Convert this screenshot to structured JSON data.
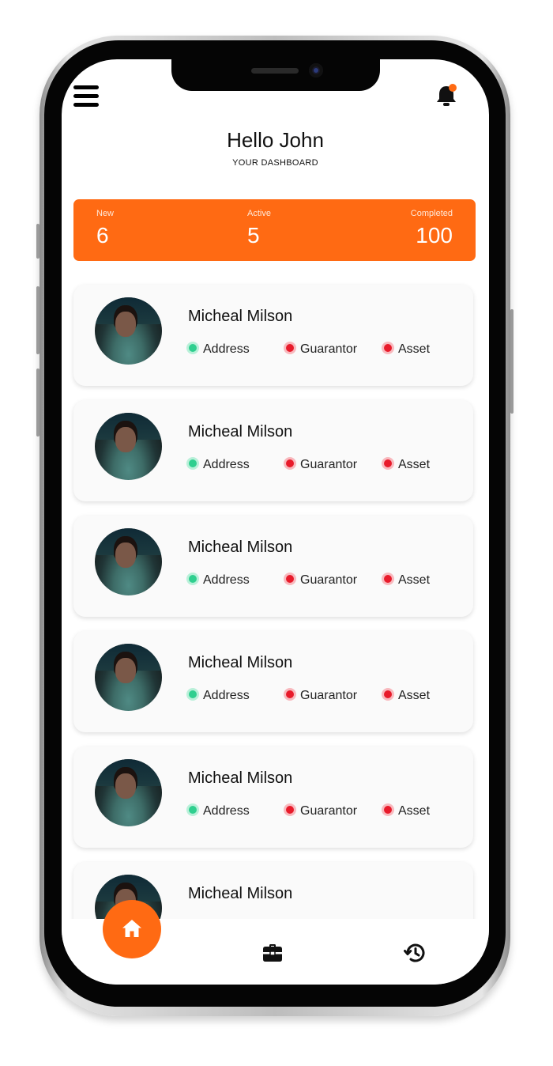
{
  "header": {
    "greeting": "Hello John",
    "subtitle": "YOUR DASHBOARD",
    "menu_icon": "hamburger-menu-icon",
    "notification_icon": "bell-icon"
  },
  "stats": [
    {
      "label": "New",
      "value": "6"
    },
    {
      "label": "Active",
      "value": "5"
    },
    {
      "label": "Completed",
      "value": "100"
    }
  ],
  "list": [
    {
      "name": "Micheal Milson",
      "tags": [
        {
          "label": "Address",
          "status": "green"
        },
        {
          "label": "Guarantor",
          "status": "red"
        },
        {
          "label": "Asset",
          "status": "red"
        }
      ]
    },
    {
      "name": "Micheal Milson",
      "tags": [
        {
          "label": "Address",
          "status": "green"
        },
        {
          "label": "Guarantor",
          "status": "red"
        },
        {
          "label": "Asset",
          "status": "red"
        }
      ]
    },
    {
      "name": "Micheal Milson",
      "tags": [
        {
          "label": "Address",
          "status": "green"
        },
        {
          "label": "Guarantor",
          "status": "red"
        },
        {
          "label": "Asset",
          "status": "red"
        }
      ]
    },
    {
      "name": "Micheal Milson",
      "tags": [
        {
          "label": "Address",
          "status": "green"
        },
        {
          "label": "Guarantor",
          "status": "red"
        },
        {
          "label": "Asset",
          "status": "red"
        }
      ]
    },
    {
      "name": "Micheal Milson",
      "tags": [
        {
          "label": "Address",
          "status": "green"
        },
        {
          "label": "Guarantor",
          "status": "red"
        },
        {
          "label": "Asset",
          "status": "red"
        }
      ]
    },
    {
      "name": "Micheal Milson",
      "tags": []
    }
  ],
  "nav": {
    "items": [
      "home-icon",
      "briefcase-icon",
      "history-icon"
    ],
    "active": "home-icon"
  },
  "colors": {
    "accent": "#ff6a13",
    "status_green": "#2fcf8f",
    "status_red": "#e81b2b"
  }
}
